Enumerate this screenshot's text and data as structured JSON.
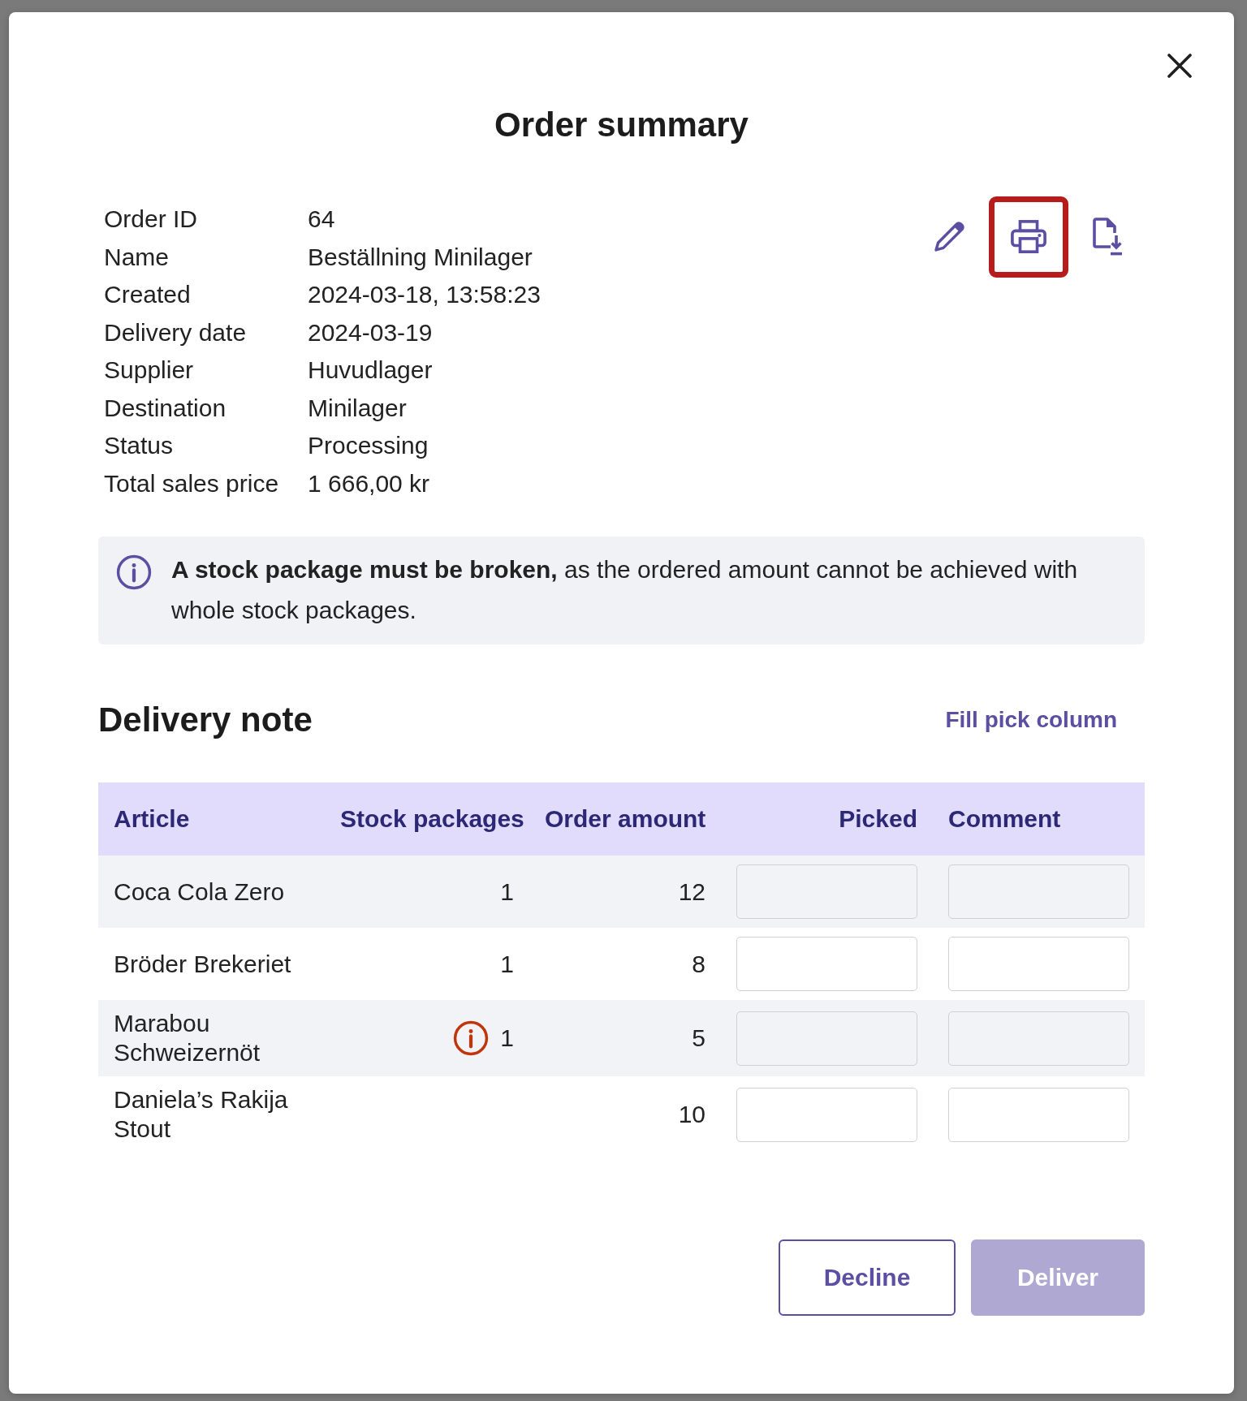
{
  "dialog": {
    "title": "Order summary"
  },
  "details": [
    {
      "label": "Order ID",
      "value": "64"
    },
    {
      "label": "Name",
      "value": "Beställning Minilager"
    },
    {
      "label": "Created",
      "value": "2024-03-18, 13:58:23"
    },
    {
      "label": "Delivery date",
      "value": "2024-03-19"
    },
    {
      "label": "Supplier",
      "value": "Huvudlager"
    },
    {
      "label": "Destination",
      "value": "Minilager"
    },
    {
      "label": "Status",
      "value": "Processing"
    },
    {
      "label": "Total sales price",
      "value": "1 666,00 kr"
    }
  ],
  "actions": [
    {
      "kind": "edit",
      "focused": false
    },
    {
      "kind": "print",
      "focused": true
    },
    {
      "kind": "download",
      "focused": false
    }
  ],
  "notice": {
    "text": "**A stock package must be broken,** as the ordered amount cannot be achieved with whole stock packages."
  },
  "delivery_note": {
    "title": "Delivery note",
    "link": "Fill pick column"
  },
  "table": {
    "columns": [
      "Article",
      "Stock packages",
      "Order amount",
      "Picked",
      "Comment"
    ],
    "rows": [
      {
        "article": "Coca Cola Zero",
        "stock_packages": "1",
        "warning": false,
        "order_amount": "12"
      },
      {
        "article": "Bröder Brekeriet",
        "stock_packages": "1",
        "warning": false,
        "order_amount": "8"
      },
      {
        "article": "Marabou Schweizernöt",
        "stock_packages": "1",
        "warning": true,
        "order_amount": "5"
      },
      {
        "article": "Daniela’s Rakija Stout",
        "warning": false,
        "order_amount": "10"
      }
    ]
  },
  "buttons": [
    {
      "label": "Decline",
      "kind": "secondary",
      "disabled": false
    },
    {
      "label": "Deliver",
      "kind": "primary",
      "disabled": true
    }
  ]
}
